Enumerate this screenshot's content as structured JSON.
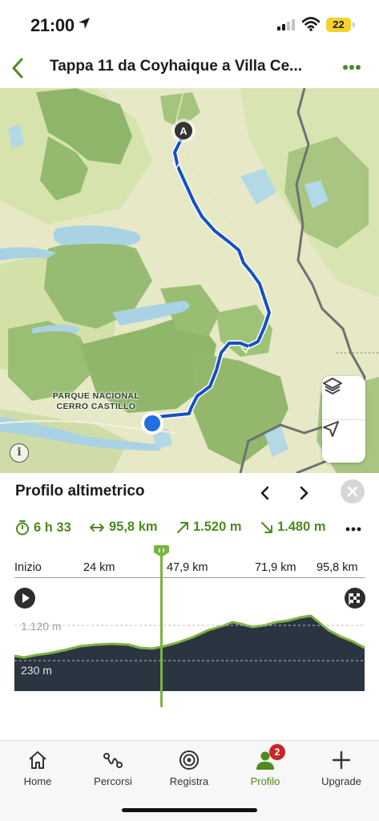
{
  "status_bar": {
    "time": "21:00",
    "battery": "22",
    "icons": [
      "location-arrow-icon",
      "signal-icon",
      "wifi-icon",
      "battery-icon"
    ]
  },
  "nav": {
    "title": "Tappa 11 da Coyhaique a Villa Ce...",
    "back_icon": "chevron-left-icon",
    "more_icon": "more-dots-icon",
    "accent": "#4e8a1f"
  },
  "map": {
    "start_marker": "A",
    "park_label_line1": "PARQUE NACIONAL",
    "park_label_line2": "CERRO CASTILLO",
    "info_glyph": "i",
    "route_color": "#1551c4",
    "border_color": "#6d7272"
  },
  "profile": {
    "title": "Profilo altimetrico",
    "duration": "6 h 33",
    "distance": "95,8 km",
    "ascent": "1.520 m",
    "descent": "1.480 m",
    "axis_start": "Inizio",
    "axis_ticks": [
      "24 km",
      "47,9 km",
      "71,9 km",
      "95,8 km"
    ],
    "elev_high_label": "1.120 m",
    "elev_low_label": "230 m",
    "scrubber_position_km": 43,
    "fill_color": "#2b3441",
    "line_color": "#7cb342"
  },
  "tabs": [
    {
      "label": "Home",
      "icon": "home-icon",
      "active": false
    },
    {
      "label": "Percorsi",
      "icon": "routes-icon",
      "active": false
    },
    {
      "label": "Registra",
      "icon": "record-icon",
      "active": false
    },
    {
      "label": "Profilo",
      "icon": "profile-icon",
      "active": true,
      "badge": "2"
    },
    {
      "label": "Upgrade",
      "icon": "plus-icon",
      "active": false
    }
  ]
}
